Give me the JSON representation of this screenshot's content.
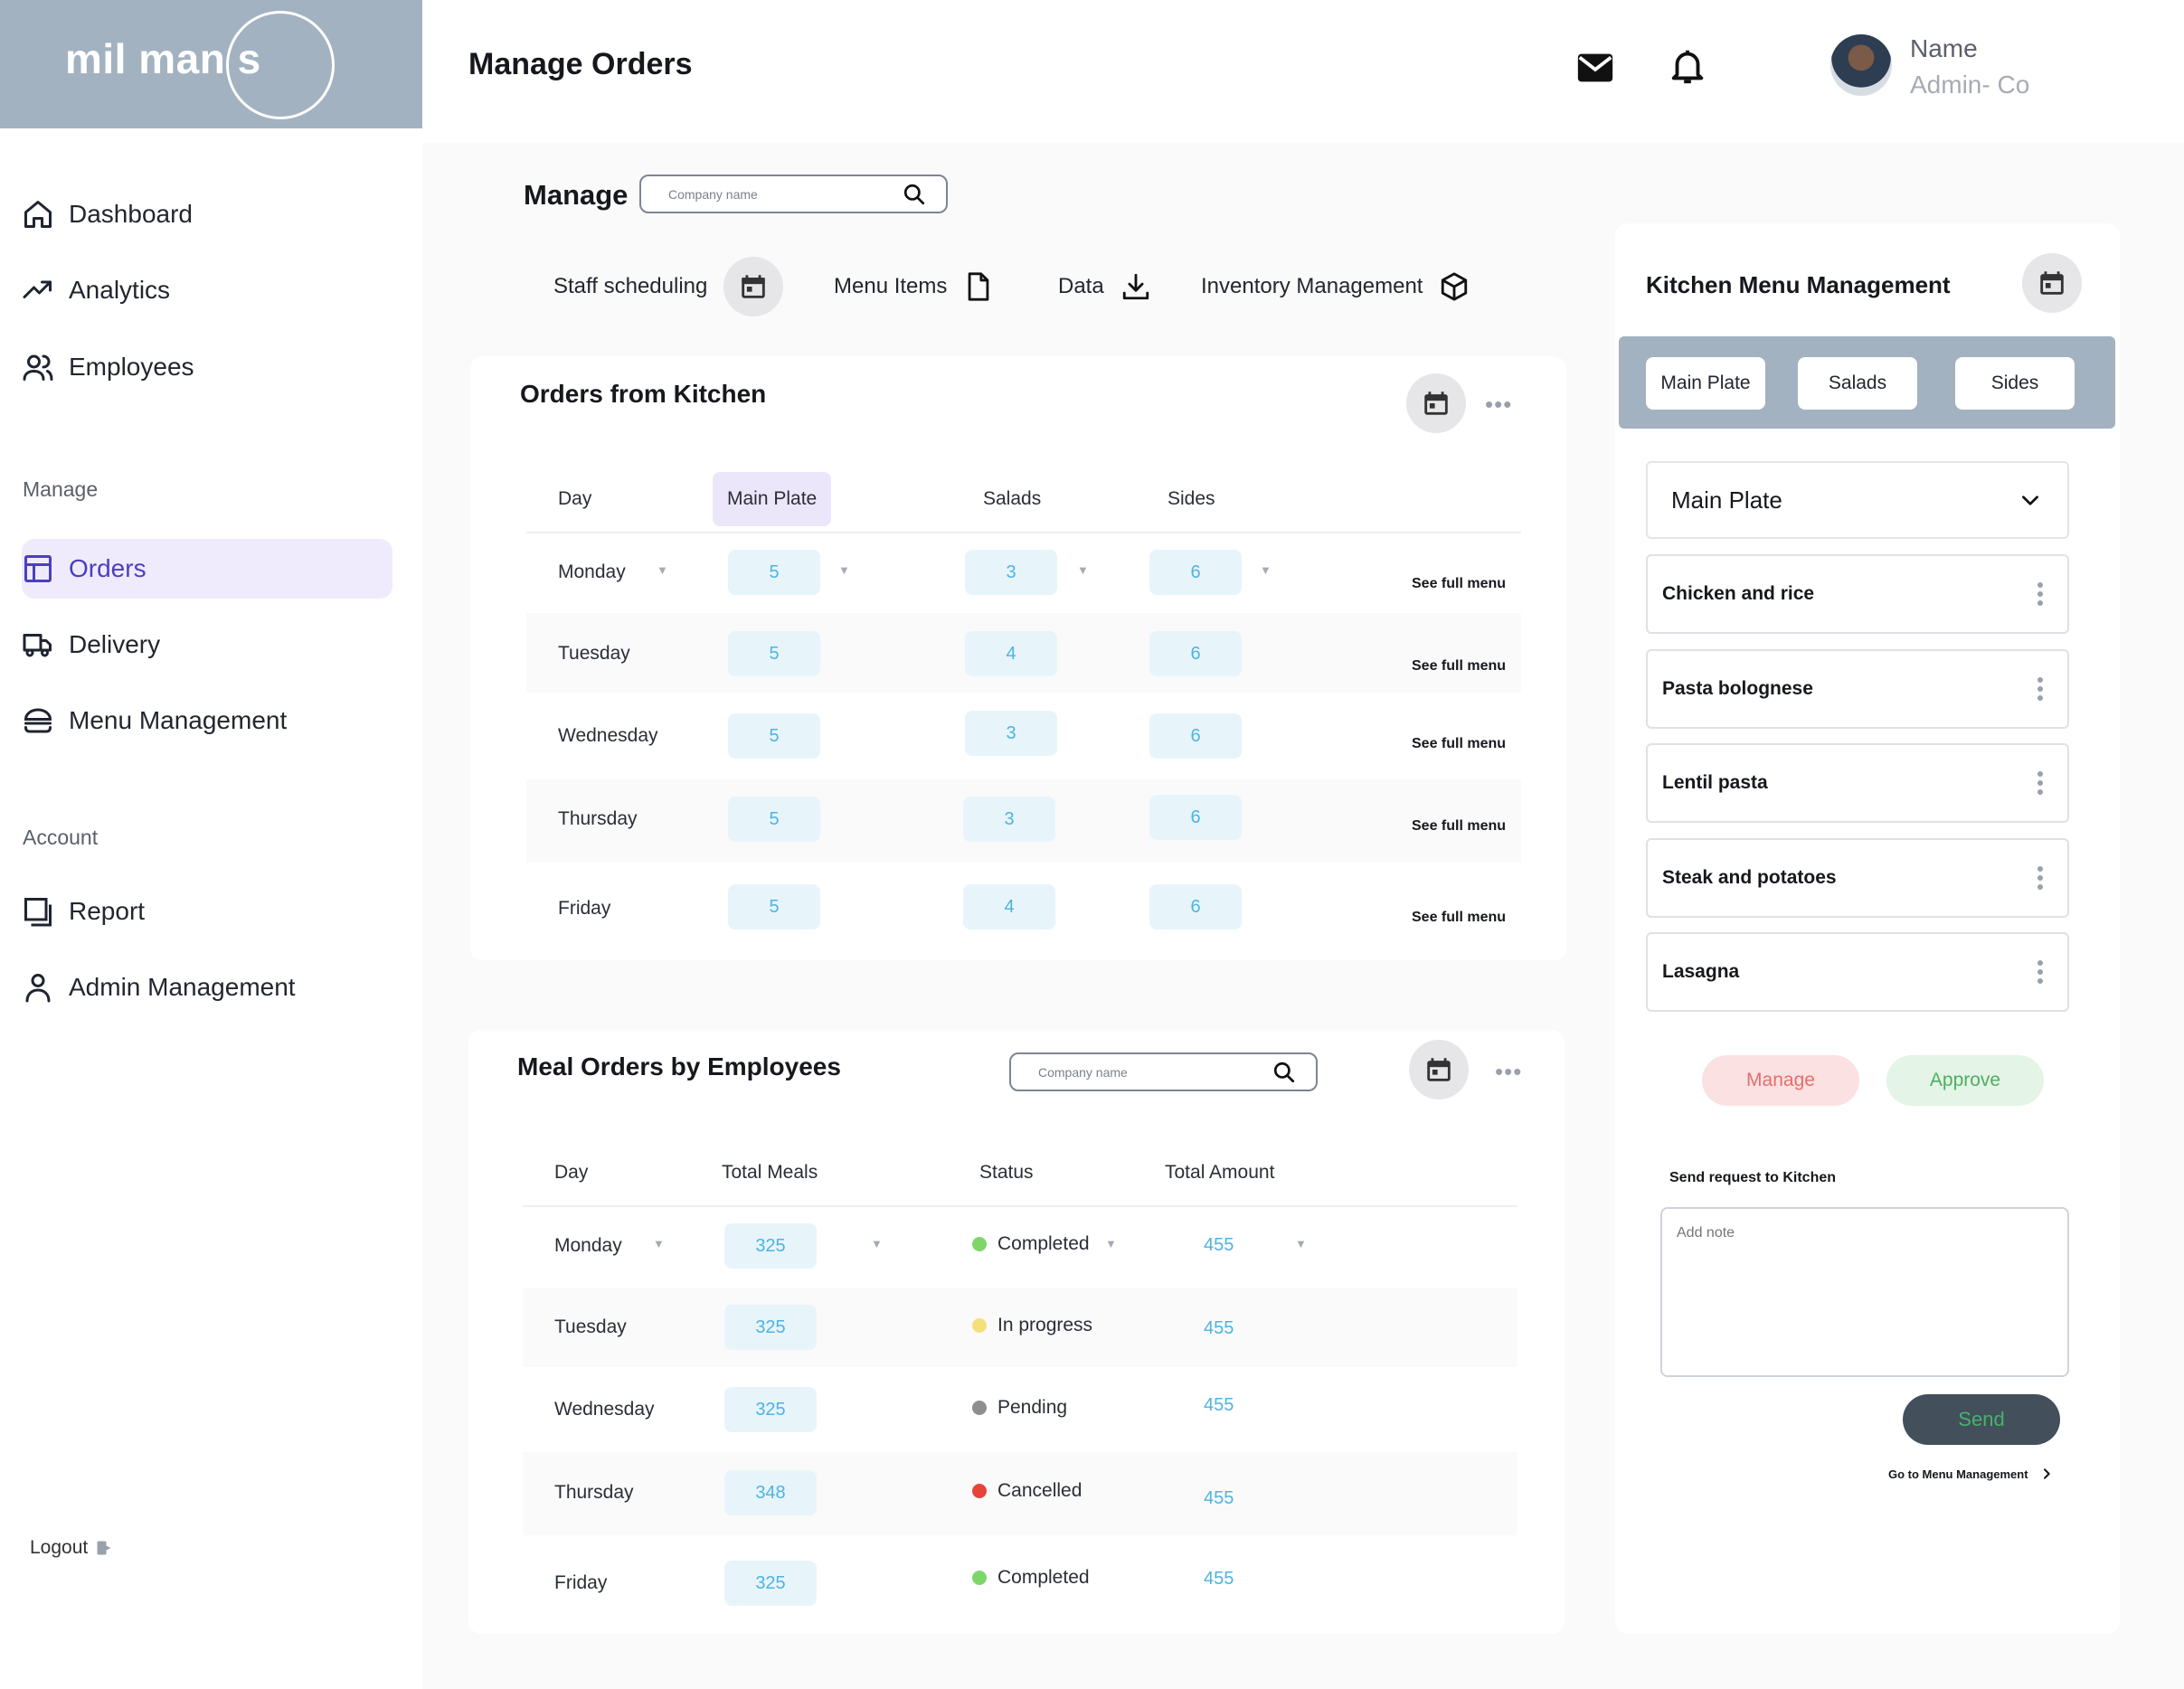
{
  "brand": {
    "logo_text": "mil man s"
  },
  "sidebar": {
    "main_items": [
      {
        "label": "Dashboard",
        "icon": "home-icon"
      },
      {
        "label": "Analytics",
        "icon": "trend-up-icon"
      },
      {
        "label": "Employees",
        "icon": "users-icon"
      }
    ],
    "manage_heading": "Manage",
    "manage_items": [
      {
        "label": "Orders",
        "icon": "layout-icon",
        "active": true
      },
      {
        "label": "Delivery",
        "icon": "truck-icon"
      },
      {
        "label": "Menu Management",
        "icon": "burger-icon"
      }
    ],
    "account_heading": "Account",
    "account_items": [
      {
        "label": "Report",
        "icon": "report-icon"
      },
      {
        "label": "Admin Management",
        "icon": "user-icon"
      }
    ],
    "logout_label": "Logout"
  },
  "header": {
    "title": "Manage Orders",
    "user_name": "Name",
    "user_role": "Admin- Co"
  },
  "manage": {
    "label": "Manage",
    "search_placeholder": "Company name",
    "tools": [
      {
        "label": "Staff scheduling",
        "icon": "calendar-icon"
      },
      {
        "label": "Menu Items",
        "icon": "file-icon"
      },
      {
        "label": "Data",
        "icon": "download-icon"
      },
      {
        "label": "Inventory Management",
        "icon": "box-icon"
      }
    ]
  },
  "kitchen_orders": {
    "title": "Orders from Kitchen",
    "columns": [
      "Day",
      "Main Plate",
      "Salads",
      "Sides"
    ],
    "rows": [
      {
        "day": "Monday",
        "main": "5",
        "salads": "3",
        "sides": "6",
        "link": "See full menu"
      },
      {
        "day": "Tuesday",
        "main": "5",
        "salads": "4",
        "sides": "6",
        "link": "See full menu"
      },
      {
        "day": "Wednesday",
        "main": "5",
        "salads": "3",
        "sides": "6",
        "link": "See full menu"
      },
      {
        "day": "Thursday",
        "main": "5",
        "salads": "3",
        "sides": "6",
        "link": "See full menu"
      },
      {
        "day": "Friday",
        "main": "5",
        "salads": "4",
        "sides": "6",
        "link": "See full menu"
      }
    ]
  },
  "employee_orders": {
    "title": "Meal Orders by Employees",
    "search_placeholder": "Company name",
    "columns": [
      "Day",
      "Total Meals",
      "Status",
      "Total Amount"
    ],
    "rows": [
      {
        "day": "Monday",
        "meals": "325",
        "status": "Completed",
        "status_color": "#7ed66b",
        "amount": "455"
      },
      {
        "day": "Tuesday",
        "meals": "325",
        "status": "In progress",
        "status_color": "#f5df7a",
        "amount": "455"
      },
      {
        "day": "Wednesday",
        "meals": "325",
        "status": "Pending",
        "status_color": "#8e8e8e",
        "amount": "455"
      },
      {
        "day": "Thursday",
        "meals": "348",
        "status": "Cancelled",
        "status_color": "#e5443a",
        "amount": "455"
      },
      {
        "day": "Friday",
        "meals": "325",
        "status": "Completed",
        "status_color": "#7ed66b",
        "amount": "455"
      }
    ]
  },
  "kitchen_menu": {
    "title": "Kitchen Menu Management",
    "tabs": [
      "Main Plate",
      "Salads",
      "Sides"
    ],
    "selected": "Main Plate",
    "items": [
      "Chicken and rice",
      "Pasta bolognese",
      "Lentil pasta",
      "Steak and potatoes",
      "Lasagna"
    ],
    "manage_label": "Manage",
    "approve_label": "Approve",
    "request_label": "Send request to Kitchen",
    "note_placeholder": "Add note",
    "send_label": "Send",
    "goto_label": "Go to Menu Management"
  },
  "colors": {
    "brand_panel": "#a3b2c0",
    "active_nav": "#efebfc",
    "pill_bg": "#e7f5fb",
    "pill_text": "#4fb3e0",
    "manage_btn_bg": "#fbe1e1",
    "manage_btn_text": "#e46e6e",
    "approve_btn_bg": "#e4f4e6",
    "approve_btn_text": "#4fae62",
    "send_btn_bg": "#434f5b"
  }
}
